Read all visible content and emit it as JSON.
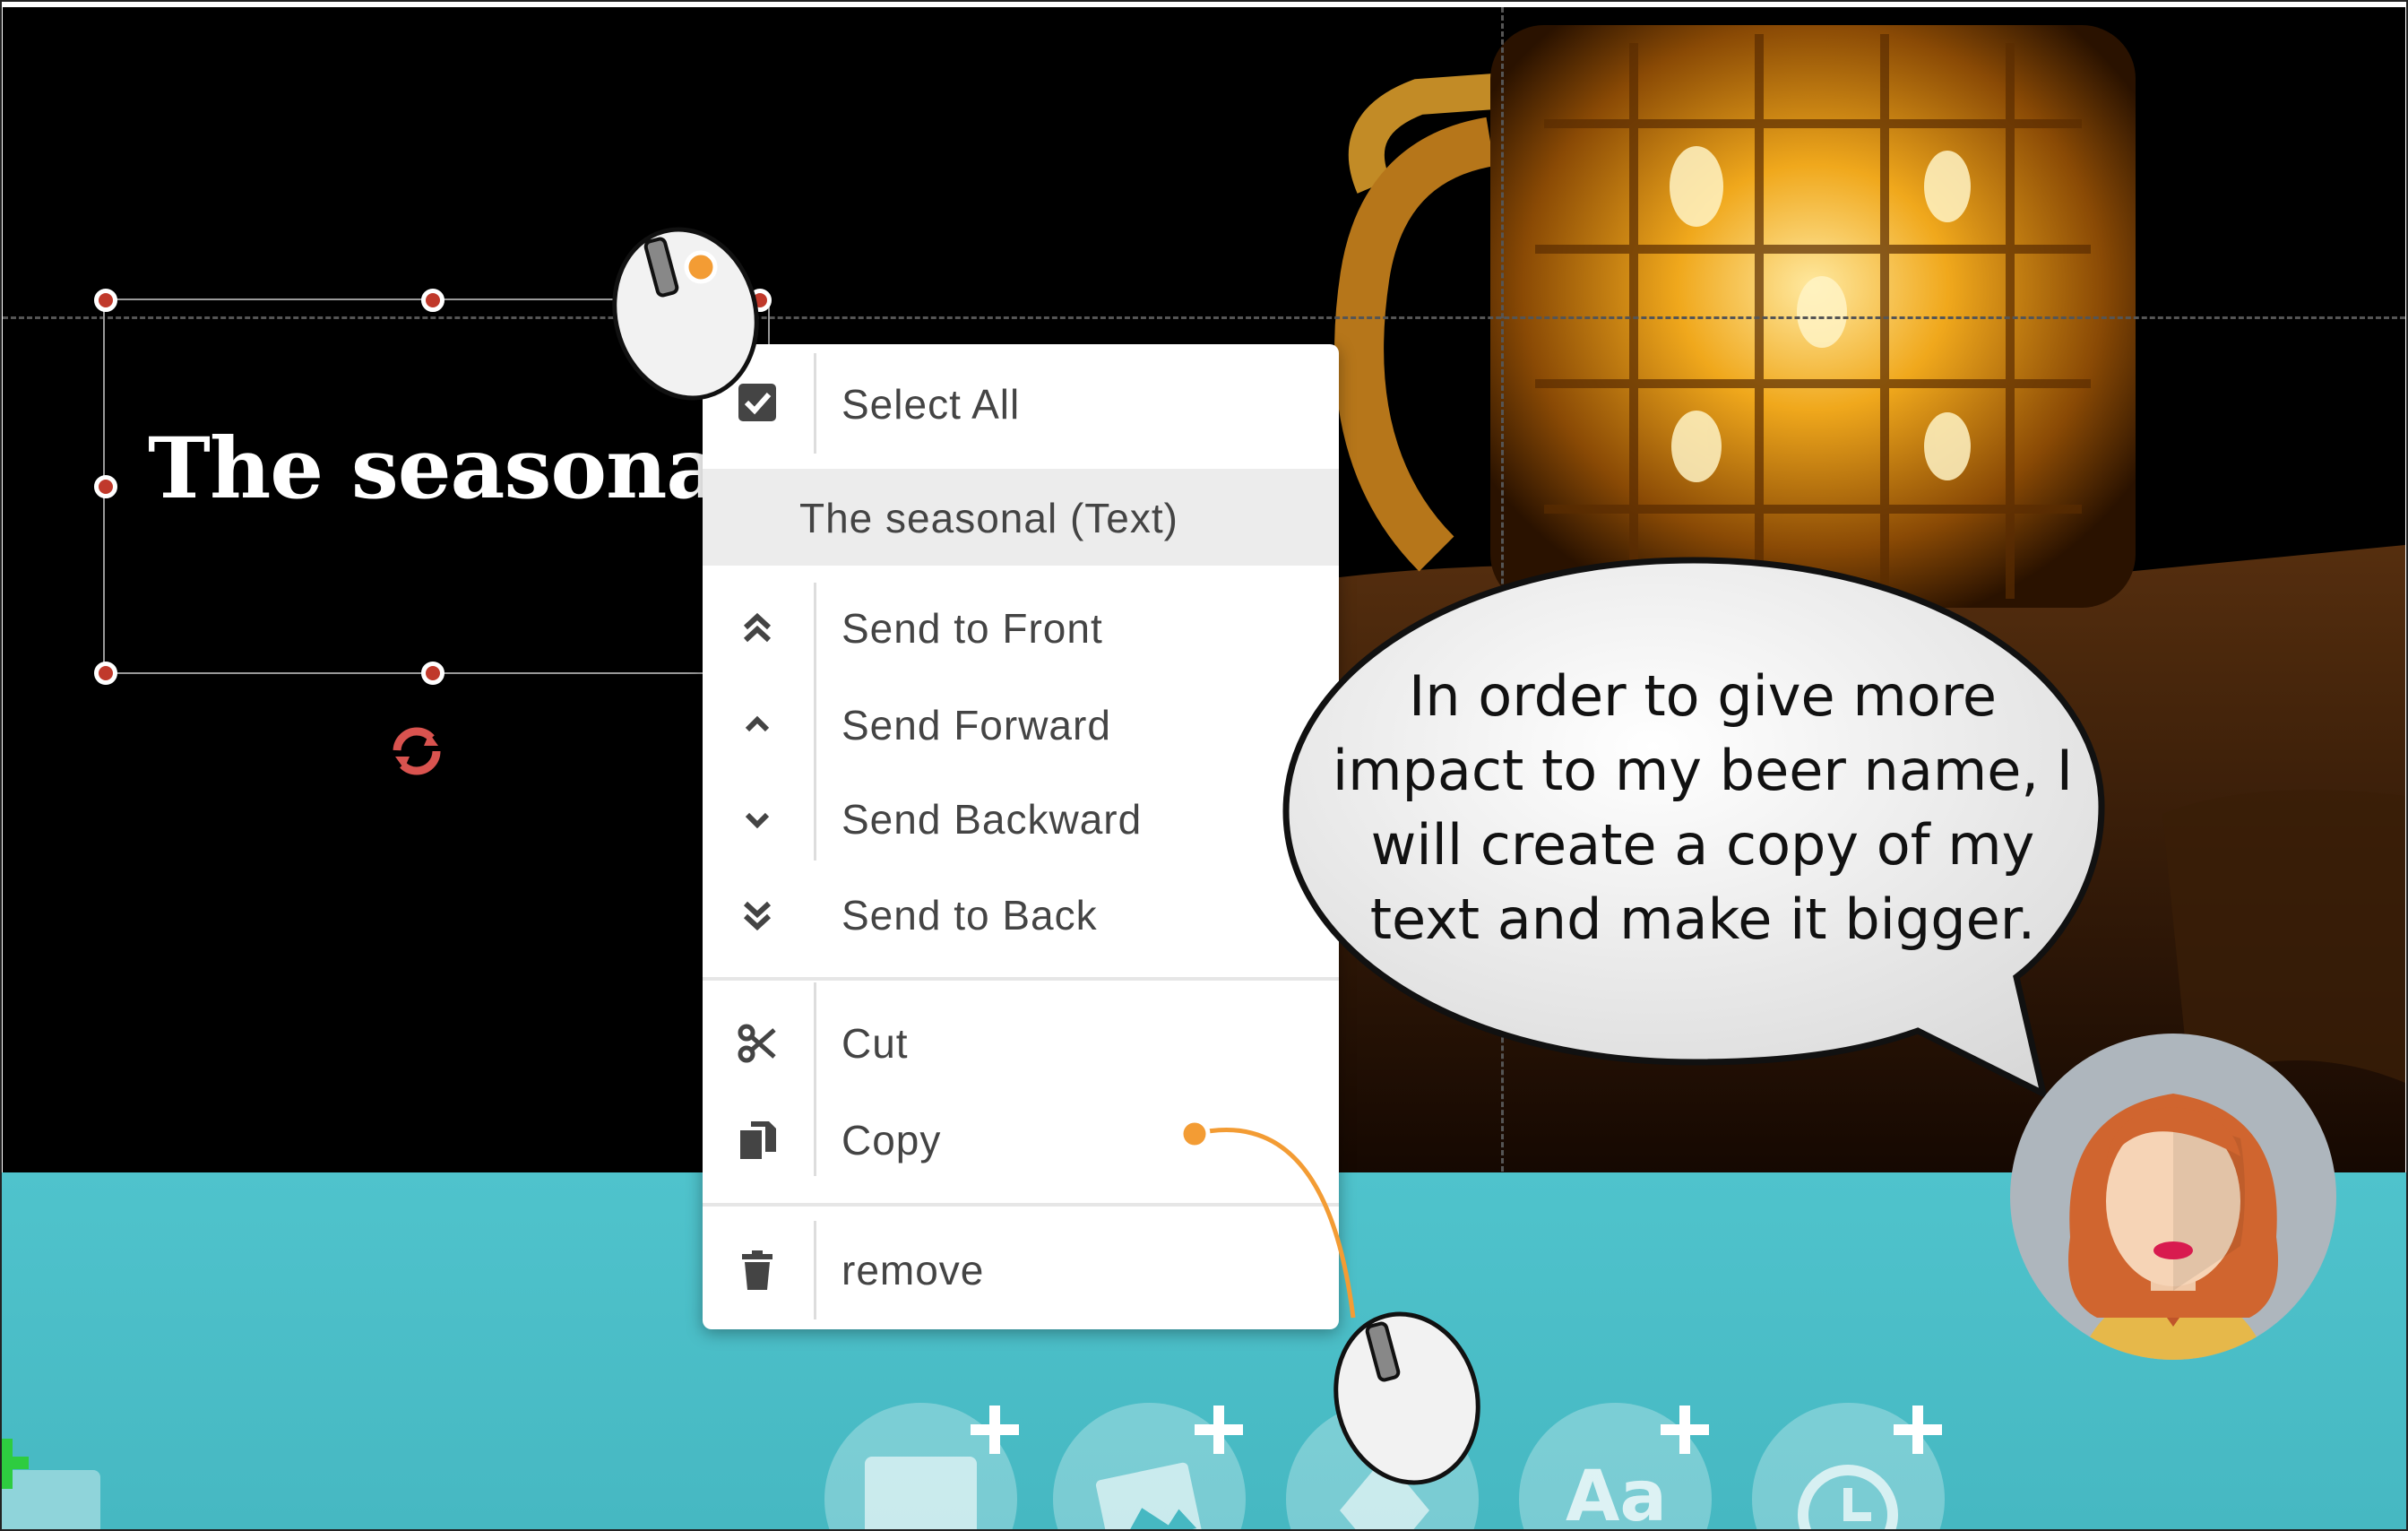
{
  "canvas": {
    "text_object": "The seasonal"
  },
  "context_menu": {
    "header": "The seasonal (Text)",
    "items": [
      {
        "label": "Select All",
        "icon": "checkbox-icon"
      },
      {
        "label": "Send to Front",
        "icon": "double-chevron-up-icon"
      },
      {
        "label": "Send Forward",
        "icon": "chevron-up-icon"
      },
      {
        "label": "Send Backward",
        "icon": "chevron-down-icon"
      },
      {
        "label": "Send to Back",
        "icon": "double-chevron-down-icon"
      },
      {
        "label": "Cut",
        "icon": "scissors-icon"
      },
      {
        "label": "Copy",
        "icon": "copy-icon"
      },
      {
        "label": "remove",
        "icon": "trash-icon"
      }
    ]
  },
  "bubble": {
    "text": "In order to give more impact to my beer name, I will create a copy of my text and make it bigger."
  },
  "toolbar": {
    "text_button_label": "Aa"
  },
  "colors": {
    "handle": "#c0392b",
    "accent_orange": "#f39c34",
    "bottom_bar": "#4fc3cc"
  }
}
